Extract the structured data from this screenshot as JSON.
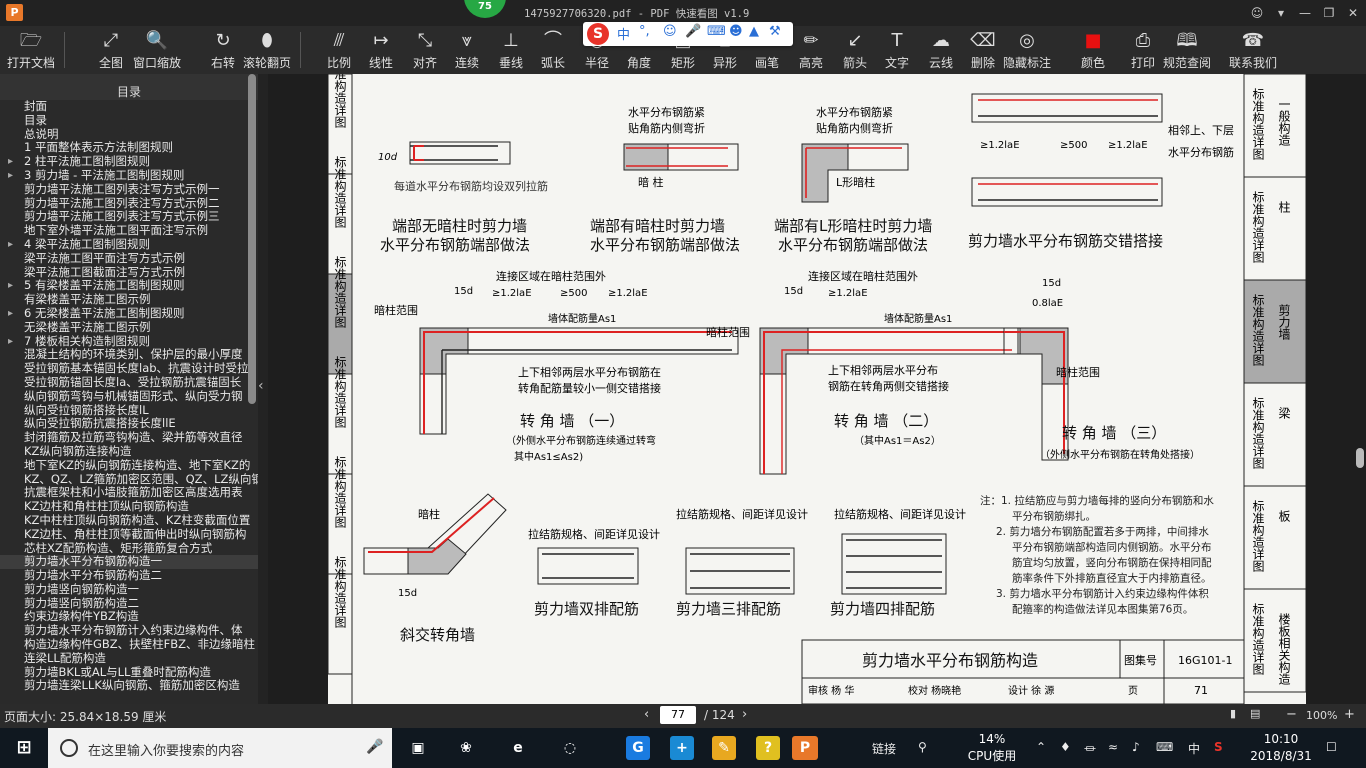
{
  "window": {
    "title": "1475927706320.pdf - PDF 快速看图 v1.9",
    "app_icon_letter": "P",
    "badge": "75"
  },
  "toolbar": {
    "items": [
      {
        "label": "打开文档",
        "icon": "folder-icon"
      },
      {
        "label": "全图",
        "icon": "fit-icon"
      },
      {
        "label": "窗口缩放",
        "icon": "zoom-icon"
      },
      {
        "label": "右转",
        "icon": "rotate-icon"
      },
      {
        "label": "滚轮翻页",
        "icon": "mouse-icon"
      },
      {
        "label": "比例",
        "icon": "scale-icon"
      },
      {
        "label": "线性",
        "icon": "linear-icon"
      },
      {
        "label": "对齐",
        "icon": "align-icon"
      },
      {
        "label": "连续",
        "icon": "continuous-icon"
      },
      {
        "label": "垂线",
        "icon": "perpendicular-icon"
      },
      {
        "label": "弧长",
        "icon": "arc-icon"
      },
      {
        "label": "半径",
        "icon": "radius-icon"
      },
      {
        "label": "角度",
        "icon": "angle-icon"
      },
      {
        "label": "矩形",
        "icon": "rect-icon"
      },
      {
        "label": "异形",
        "icon": "polygon-icon"
      },
      {
        "label": "画笔",
        "icon": "pen-icon"
      },
      {
        "label": "高亮",
        "icon": "highlight-icon"
      },
      {
        "label": "箭头",
        "icon": "arrow-icon"
      },
      {
        "label": "文字",
        "icon": "text-icon"
      },
      {
        "label": "云线",
        "icon": "cloud-icon"
      },
      {
        "label": "删除",
        "icon": "eraser-icon"
      },
      {
        "label": "隐藏标注",
        "icon": "eye-icon"
      },
      {
        "label": "颜色",
        "icon": "color-icon",
        "color": "#e81010"
      },
      {
        "label": "打印",
        "icon": "printer-icon"
      },
      {
        "label": "规范查阅",
        "icon": "book-icon"
      },
      {
        "label": "联系我们",
        "icon": "contact-icon"
      }
    ]
  },
  "ime": {
    "logo": "S",
    "mode": "中"
  },
  "sidebar": {
    "header": "目录",
    "items": [
      {
        "label": "封面",
        "arrow": false
      },
      {
        "label": "目录",
        "arrow": false
      },
      {
        "label": "总说明",
        "arrow": false
      },
      {
        "label": "1  平面整体表示方法制图规则",
        "arrow": false
      },
      {
        "label": "2  柱平法施工图制图规则",
        "arrow": true
      },
      {
        "label": "3  剪力墙 - 平法施工图制图规则",
        "arrow": true
      },
      {
        "label": "剪力墙平法施工图列表注写方式示例一",
        "arrow": false
      },
      {
        "label": "剪力墙平法施工图列表注写方式示例二",
        "arrow": false
      },
      {
        "label": "剪力墙平法施工图列表注写方式示例三",
        "arrow": false
      },
      {
        "label": "地下室外墙平法施工图平面注写示例",
        "arrow": false
      },
      {
        "label": "4  梁平法施工图制图规则",
        "arrow": true
      },
      {
        "label": "梁平法施工图平面注写方式示例",
        "arrow": false
      },
      {
        "label": "梁平法施工图截面注写方式示例",
        "arrow": false
      },
      {
        "label": "5  有梁楼盖平法施工图制图规则",
        "arrow": true
      },
      {
        "label": "有梁楼盖平法施工图示例",
        "arrow": false
      },
      {
        "label": "6  无梁楼盖平法施工图制图规则",
        "arrow": true
      },
      {
        "label": "无梁楼盖平法施工图示例",
        "arrow": false
      },
      {
        "label": "7  楼板相关构造制图规则",
        "arrow": true
      },
      {
        "label": "混凝土结构的环境类别、保护层的最小厚度",
        "arrow": false
      },
      {
        "label": "受拉钢筋基本锚固长度lab、抗震设计时受拉",
        "arrow": false
      },
      {
        "label": "受拉钢筋锚固长度la、受拉钢筋抗震锚固长",
        "arrow": false
      },
      {
        "label": "纵向钢筋弯钩与机械锚固形式、纵向受力钢",
        "arrow": false
      },
      {
        "label": "纵向受拉钢筋搭接长度lL",
        "arrow": false
      },
      {
        "label": "纵向受拉钢筋抗震搭接长度llE",
        "arrow": false
      },
      {
        "label": "封闭箍筋及拉筋弯钩构造、梁并筋等效直径",
        "arrow": false
      },
      {
        "label": "KZ纵向钢筋连接构造",
        "arrow": false
      },
      {
        "label": "地下室KZ的纵向钢筋连接构造、地下室KZ的",
        "arrow": false
      },
      {
        "label": "KZ、QZ、LZ箍筋加密区范围、QZ、LZ纵向钢",
        "arrow": false
      },
      {
        "label": "抗震框架柱和小墙肢箍筋加密区高度选用表",
        "arrow": false
      },
      {
        "label": "KZ边柱和角柱柱顶纵向钢筋构造",
        "arrow": false
      },
      {
        "label": "KZ中柱柱顶纵向钢筋构造、KZ柱变截面位置",
        "arrow": false
      },
      {
        "label": "KZ边柱、角柱柱顶等截面伸出时纵向钢筋构",
        "arrow": false
      },
      {
        "label": "芯柱XZ配筋构造、矩形箍筋复合方式",
        "arrow": false
      },
      {
        "label": "剪力墙水平分布钢筋构造一",
        "arrow": false,
        "selected": true
      },
      {
        "label": "剪力墙水平分布钢筋构造二",
        "arrow": false
      },
      {
        "label": "剪力墙竖向钢筋构造一",
        "arrow": false
      },
      {
        "label": "剪力墙竖向钢筋构造二",
        "arrow": false
      },
      {
        "label": "约束边缘构件YBZ构造",
        "arrow": false
      },
      {
        "label": "剪力墙水平分布钢筋计入约束边缘构件、体",
        "arrow": false
      },
      {
        "label": "构造边缘构件GBZ、扶壁柱FBZ、非边缘暗柱",
        "arrow": false
      },
      {
        "label": "连梁LL配筋构造",
        "arrow": false
      },
      {
        "label": "剪力墙BKL或AL与LL重叠时配筋构造",
        "arrow": false
      },
      {
        "label": "剪力墙连梁LLK纵向钢筋、箍筋加密区构造",
        "arrow": false
      }
    ]
  },
  "page": {
    "side_tabs": [
      "标准构造详图",
      "标准构造详图",
      "标准构造详图",
      "标准构造详图",
      "标准构造详图",
      "标准构造详图"
    ],
    "right_tabs": [
      {
        "top": "标准构造详图",
        "bottom": "一般构造"
      },
      {
        "top": "标准构造详图",
        "bottom": "柱"
      },
      {
        "top": "标准构造详图",
        "bottom": "剪力墙"
      },
      {
        "top": "标准构造详图",
        "bottom": "梁"
      },
      {
        "top": "标准构造详图",
        "bottom": "板"
      },
      {
        "top": "标准构造详图",
        "bottom": "楼板相关构造"
      }
    ],
    "captions": {
      "c1a": "端部无暗柱时剪力墙",
      "c1b": "水平分布钢筋端部做法",
      "c2a": "端部有暗柱时剪力墙",
      "c2b": "水平分布钢筋端部做法",
      "c3a": "端部有L形暗柱时剪力墙",
      "c3b": "水平分布钢筋端部做法",
      "c4": "剪力墙水平分布钢筋交错搭接",
      "corner1": "转 角 墙 （一）",
      "corner1_note1": "（外侧水平分布钢筋连续通过转弯",
      "corner1_note2": "其中As1≤As2)",
      "corner2": "转 角 墙 （二）",
      "corner2_note": "（其中As1＝As2）",
      "corner3": "转 角 墙 （三）",
      "corner3_note": "（外侧水平分布钢筋在转角处搭接）",
      "oblique": "斜交转角墙",
      "double": "剪力墙双排配筋",
      "triple": "剪力墙三排配筋",
      "quad": "剪力墙四排配筋"
    },
    "annotations": {
      "every_bar": "每道水平分布钢筋均设双列拉筋",
      "hz_tight1": "水平分布钢筋紧",
      "hz_tight2": "贴角筋内侧弯折",
      "anzhu": "暗 柱",
      "lanzhu": "L形暗柱",
      "adjacent1": "相邻上、下层",
      "adjacent2": "水平分布钢筋",
      "conn_zone": "连接区域在暗柱范围外",
      "anzhu_range": "暗柱范围",
      "wall_bars": "墙体配筋量As1",
      "stagger1": "上下相邻两层水平分布钢筋在",
      "stagger2": "转角配筋量较小一侧交错搭接",
      "stagger3": "上下相邻两层水平分布",
      "stagger4": "钢筋在转角两侧交错搭接",
      "anzhu2": "暗柱",
      "tie_spec": "拉结筋规格、间距详见设计",
      "d10": "10d",
      "d15": "15d",
      "lae12": "≥1.2laE",
      "ge500": "≥500",
      "lae08": "0.8laE"
    },
    "notes": [
      "注：1. 拉结筋应与剪力墙每排的竖向分布钢筋和水",
      "平分布钢筋绑扎。",
      "2. 剪力墙分布钢筋配置若多于两排，中间排水",
      "平分布钢筋端部构造同内侧钢筋。水平分布",
      "筋宜均匀放置，竖向分布钢筋在保持相同配",
      "筋率条件下外排筋直径宜大于内排筋直径。",
      "3. 剪力墙水平分布钢筋计入约束边缘构件体积",
      "配箍率的构造做法详见本图集第76页。"
    ],
    "titleblock": {
      "title": "剪力墙水平分布钢筋构造",
      "atlas_label": "图集号",
      "atlas_no": "16G101-1",
      "review": "审核 杨 华",
      "check": "校对 杨晓艳",
      "design": "设计 徐 源",
      "page_label": "页",
      "page_no": "71"
    }
  },
  "status": {
    "page_size": "页面大小: 25.84×18.59 厘米",
    "current_page": "77",
    "total_pages": "/ 124",
    "zoom": "100%"
  },
  "taskbar": {
    "search_placeholder": "在这里输入你要搜索的内容",
    "link_label": "链接",
    "cpu_percent": "14%",
    "cpu_label": "CPU使用",
    "ime_lang": "中",
    "time": "10:10",
    "date": "2018/8/31"
  }
}
